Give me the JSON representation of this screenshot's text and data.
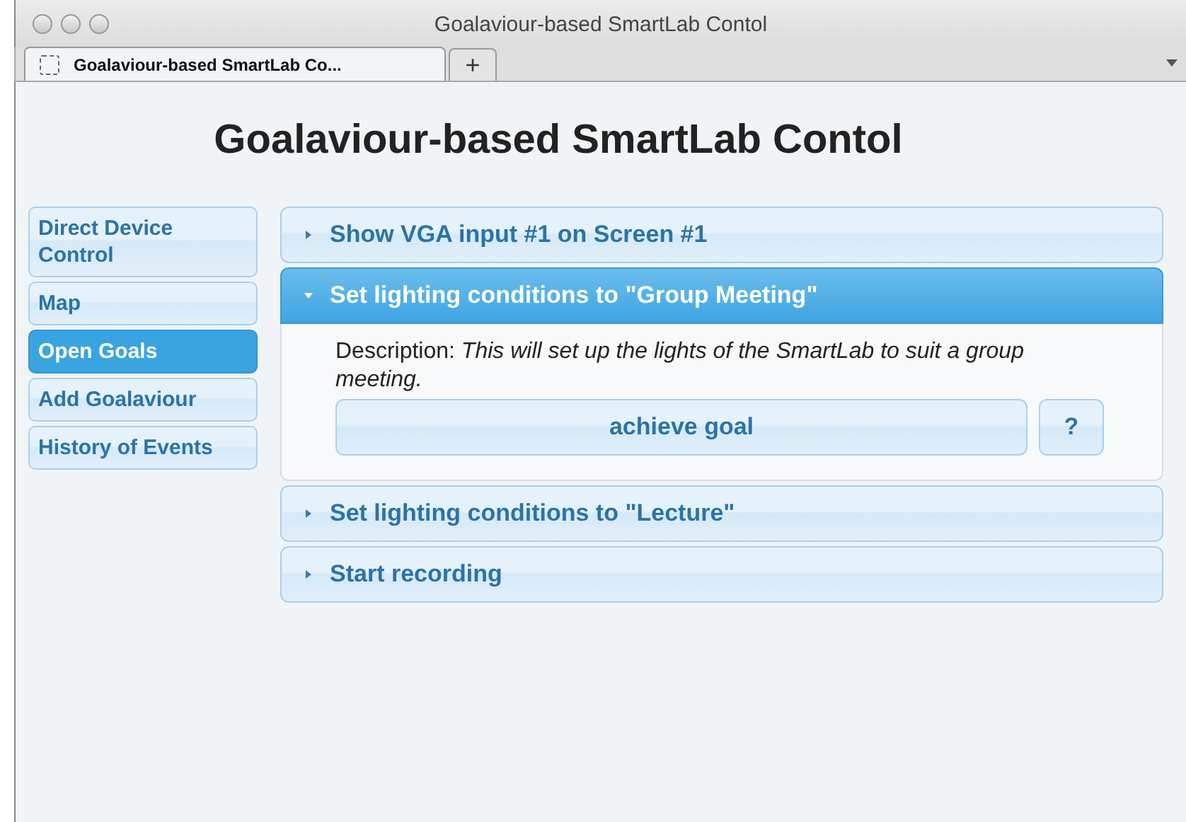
{
  "window": {
    "title": "Goalaviour-based SmartLab Contol"
  },
  "tabs": [
    {
      "label": "Goalaviour-based SmartLab Co...",
      "selected": true
    }
  ],
  "new_tab_button": "+",
  "page_title": "Goalaviour-based SmartLab Contol",
  "sidebar": {
    "items": [
      {
        "label": "Direct Device Control",
        "selected": false
      },
      {
        "label": "Map",
        "selected": false
      },
      {
        "label": "Open Goals",
        "selected": true
      },
      {
        "label": "Add Goalaviour",
        "selected": false
      },
      {
        "label": "History of Events",
        "selected": false
      }
    ]
  },
  "goals": [
    {
      "title": "Show VGA input #1 on Screen #1",
      "expanded": false
    },
    {
      "title": "Set lighting conditions to \"Group Meeting\"",
      "expanded": true,
      "description": "Description: *This will set up the lights of the SmartLab to suit a group meeting.*",
      "action": "achieve goal",
      "help": "?"
    },
    {
      "title": "Set lighting conditions to \"Lecture\"",
      "expanded": false
    },
    {
      "title": "Start recording",
      "expanded": false
    }
  ]
}
